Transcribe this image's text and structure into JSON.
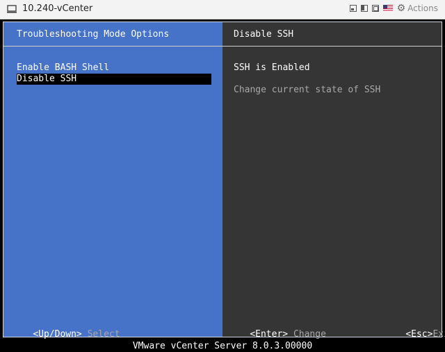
{
  "window": {
    "title": "10.240-vCenter",
    "actions_label": "Actions",
    "icons": [
      "monitor-icon",
      "window-mode-1-icon",
      "window-mode-2-icon",
      "window-mode-3-icon",
      "us-flag-icon",
      "gear-icon"
    ]
  },
  "left_pane": {
    "header": "Troubleshooting Mode Options",
    "menu_items": [
      {
        "label": "Enable BASH Shell",
        "selected": false
      },
      {
        "label": "Disable SSH",
        "selected": true
      }
    ],
    "footer": {
      "key": "<Up/Down>",
      "action": "Select"
    }
  },
  "right_pane": {
    "header": "Disable SSH",
    "state_text": "SSH is Enabled",
    "description": "Change current state of SSH",
    "footer_center": {
      "key": "<Enter>",
      "action": "Change"
    },
    "footer_right": {
      "key": "<Esc>",
      "action": "Exit"
    }
  },
  "status_bar": {
    "text": "VMware vCenter Server 8.0.3.00000"
  },
  "colors": {
    "left_pane_bg": "#4673c7",
    "right_pane_bg": "#353535",
    "selection_bg": "#000000",
    "dim_text": "#a8a8a8"
  }
}
